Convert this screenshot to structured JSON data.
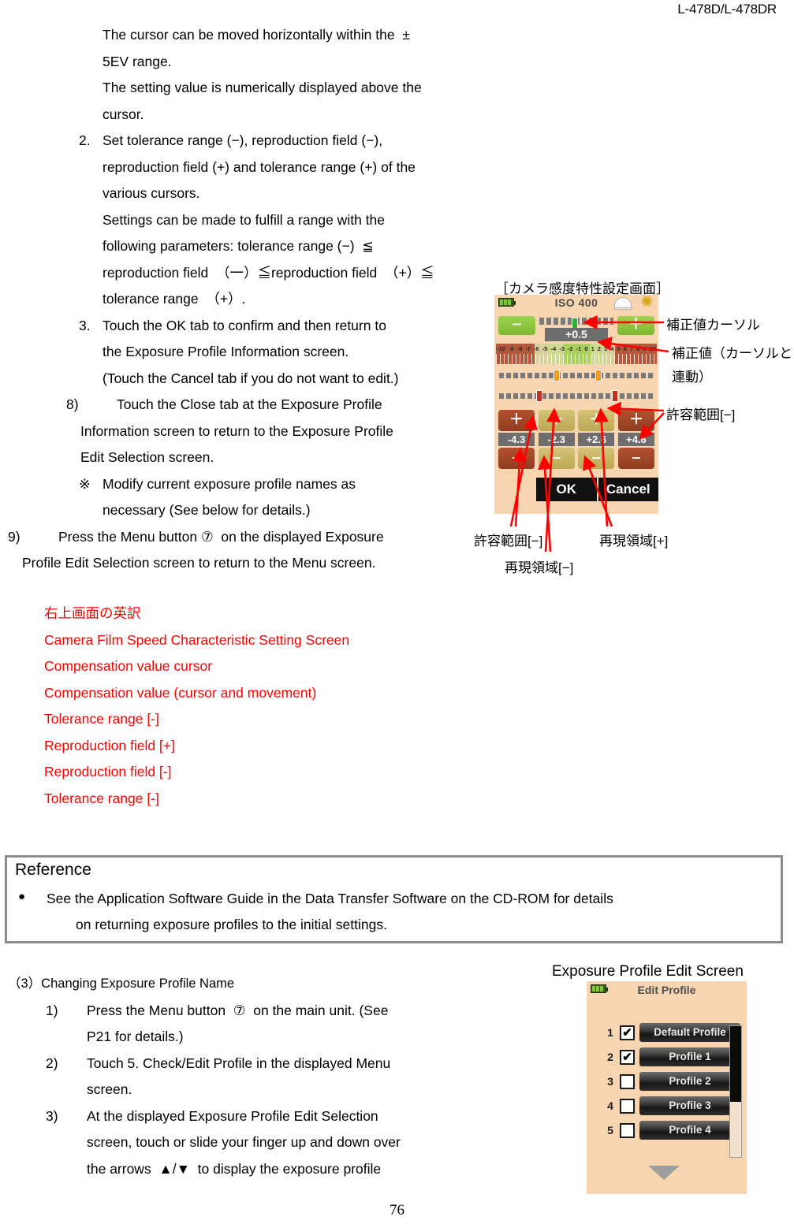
{
  "header": {
    "model": "L-478D/L-478DR"
  },
  "body_lines": [
    {
      "indent": "ind-a",
      "text": "The cursor can be moved horizontally within the  ±"
    },
    {
      "indent": "ind-a",
      "text": "5EV range."
    },
    {
      "indent": "ind-a",
      "text": "The setting value is numerically displayed above the"
    },
    {
      "indent": "ind-a",
      "text": "cursor."
    }
  ],
  "step2": {
    "label": "2.",
    "lines": [
      "Set tolerance range (−), reproduction field (−),",
      "reproduction field (+) and tolerance range (+) of the",
      "various cursors.",
      "Settings can be made to fulfill a range with the",
      "following parameters: tolerance range (−)  ≦",
      "reproduction field  （一）≦reproduction field  （+）≦",
      "tolerance range  （+）."
    ]
  },
  "step3": {
    "label": "3.",
    "lines": [
      "Touch the OK tab to confirm and then return to",
      "the Exposure Profile Information screen.",
      "(Touch the Cancel tab if you do not want to edit.)"
    ]
  },
  "step8": {
    "label": "8)",
    "lines": [
      "Touch the Close tab at the Exposure Profile",
      "Information screen to return to the Exposure Profile",
      "Edit Selection screen."
    ]
  },
  "note": {
    "mark": "※",
    "lines": [
      "Modify current exposure profile names as",
      "necessary (See below for details.)"
    ]
  },
  "step9": {
    "label": "9)",
    "lines": [
      "Press the Menu button ⑦  on the displayed Exposure",
      "Profile Edit Selection screen to return to the Menu screen."
    ]
  },
  "translation_block": {
    "heading": "右上画面の英訳",
    "color": "#ff0000",
    "lines": [
      "Camera Film Speed Characteristic Setting Screen",
      "Compensation value cursor",
      "Compensation value (cursor and movement)",
      "Tolerance range [-]",
      "Reproduction field [+]",
      "Reproduction field [-]",
      "Tolerance range [-]"
    ]
  },
  "reference": {
    "title": "Reference",
    "bullet": "●",
    "line1": "See the Application Software Guide in the Data Transfer Software on the CD-ROM for details",
    "line2": "on returning exposure profiles to the initial settings."
  },
  "section3": {
    "title": "（3）Changing Exposure Profile Name",
    "items": [
      {
        "label": "1)",
        "lines": [
          "Press the Menu button  ⑦  on the main unit. (See",
          "P21 for details.)"
        ]
      },
      {
        "label": "2)",
        "lines": [
          "Touch 5. Check/Edit Profile in the displayed Menu",
          "screen."
        ]
      },
      {
        "label": "3)",
        "lines": [
          "At the displayed Exposure Profile Edit Selection",
          "screen, touch or slide your finger up and down over",
          "the arrows  ▲/▼  to display the exposure profile"
        ]
      }
    ]
  },
  "page_number": "76",
  "device1": {
    "caption": "［カメラ感度特性設定画面］",
    "iso_label": "ISO 400",
    "minus_button": "‒",
    "plus_button": "＋",
    "compensation_value": "+0.5",
    "ruler_numbers": [
      "-10",
      "-9",
      "-8",
      "-7",
      "-6",
      "-5",
      "-4",
      "-3",
      "-2",
      "-1",
      "0",
      "1",
      "2",
      "3",
      "4",
      "5",
      "6",
      "7",
      "8",
      "9",
      "10"
    ],
    "cursor_values": [
      "-4.3",
      "-2.3",
      "+2.6",
      "+4.6"
    ],
    "control_plus": "＋",
    "control_minus": "‒",
    "ok_label": "OK",
    "cancel_label": "Cancel",
    "callouts": {
      "cursor": "補正値カーソル",
      "value": "補正値（カーソルと連動）",
      "tolerance_right": "許容範囲[−]",
      "tolerance_bottom": "許容範囲[−]",
      "reproduction_minus": "再現領域[−]",
      "reproduction_plus": "再現領域[+]"
    },
    "colors": {
      "screen_bg": "#f6d5b0",
      "green_button": "#8dc63f",
      "cursor_green": "#2fae2f",
      "cursor_orange": "#f39a21",
      "cursor_red": "#c0321c",
      "value_chip": "#6e6e6e",
      "arrow_red": "#ff0000"
    }
  },
  "device2": {
    "caption": "Exposure Profile Edit Screen",
    "title": "Edit Profile",
    "rows": [
      {
        "index": "1",
        "checked": true,
        "name": "Default Profile"
      },
      {
        "index": "2",
        "checked": true,
        "name": "Profile 1"
      },
      {
        "index": "3",
        "checked": false,
        "name": "Profile 2"
      },
      {
        "index": "4",
        "checked": false,
        "name": "Profile 3"
      },
      {
        "index": "5",
        "checked": false,
        "name": "Profile 4"
      }
    ],
    "check_glyph": "✔",
    "colors": {
      "screen_bg": "#f6d5b0",
      "button": "#2f2f2f"
    }
  }
}
